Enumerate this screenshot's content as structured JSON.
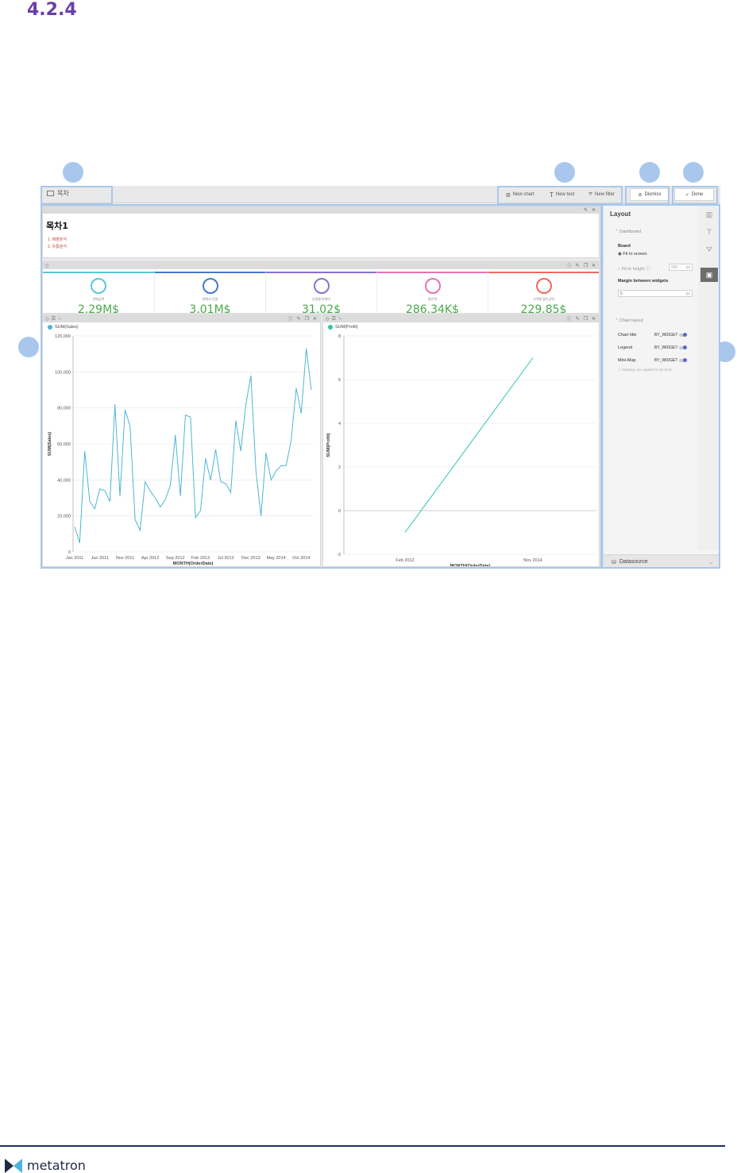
{
  "doc": {
    "section_number": "4.2.4",
    "brand": "metatron"
  },
  "toolbar": {
    "title": "목차",
    "new_chart": "New chart",
    "new_text": "New text",
    "new_filter": "New filter",
    "dismiss": "Dismiss",
    "done": "Done"
  },
  "text_widget": {
    "heading": "목차1",
    "links": [
      "1. 매출분석",
      "2. 유통분석"
    ]
  },
  "kpis": [
    {
      "label": "판매금액",
      "value": "2.29M$",
      "color": "#5bc4d9"
    },
    {
      "label": "판매자 인원",
      "value": "3.01M$",
      "color": "#4678c7"
    },
    {
      "label": "상품별 판매가",
      "value": "31.02$",
      "color": "#8a6fd0"
    },
    {
      "label": "할인액",
      "value": "286.34K$",
      "color": "#e870b4"
    },
    {
      "label": "고객별 할인금액",
      "value": "229.85$",
      "color": "#f06a5a"
    }
  ],
  "chart_data": [
    {
      "type": "line",
      "title": "",
      "legend": "SUM(Sales)",
      "xlabel": "MONTH(OrderDate)",
      "ylabel": "SUM(Sales)",
      "ylim": [
        0,
        120000
      ],
      "yticks": [
        "0",
        "20,000",
        "40,000",
        "60,000",
        "80,000",
        "100,000",
        "120,000"
      ],
      "xticks": [
        "Jan 2011",
        "Jun 2011",
        "Nov 2011",
        "Apr 2012",
        "Sep 2012",
        "Feb 2013",
        "Jul 2013",
        "Dec 2013",
        "May 2014",
        "Oct 2014"
      ],
      "color": "#4db6d6",
      "values": [
        14000,
        5000,
        56000,
        28000,
        24000,
        35000,
        34000,
        28000,
        82000,
        31000,
        79000,
        70000,
        18000,
        12000,
        39000,
        34000,
        30000,
        25000,
        29000,
        37000,
        65000,
        31000,
        76000,
        75000,
        19000,
        23000,
        52000,
        40000,
        57000,
        39000,
        38000,
        33000,
        73000,
        56000,
        82000,
        98000,
        45000,
        20000,
        55000,
        40000,
        45000,
        48000,
        48000,
        62000,
        91000,
        77000,
        113000,
        90000
      ]
    },
    {
      "type": "line",
      "title": "",
      "legend": "SUM(Profit)",
      "xlabel": "MONTH(OrderDate)",
      "ylabel": "SUM(Profit)",
      "ylim": [
        -2,
        8
      ],
      "yticks": [
        "-2",
        "0",
        "2",
        "4",
        "6",
        "8"
      ],
      "xticks": [
        "Feb 2012",
        "Nov 2014"
      ],
      "color": "#2dc6b0",
      "points": [
        {
          "x": "Feb 2012",
          "y": -1
        },
        {
          "x": "Nov 2014",
          "y": 7
        }
      ]
    }
  ],
  "panel": {
    "title": "Layout",
    "dashboard_section": "Dashboard",
    "board_label": "Board",
    "fit_to_screen": "Fit to screen",
    "fit_to_height": "Fit to height",
    "height_value": "900",
    "unit": "px",
    "margin_label": "Margin between widgets",
    "margin_value": "5",
    "chart_layout_section": "Chart layout",
    "settings": [
      {
        "label": "Chart title",
        "value": "BY_WIDGET"
      },
      {
        "label": "Legend",
        "value": "BY_WIDGET"
      },
      {
        "label": "Mini-Map",
        "value": "BY_WIDGET"
      }
    ],
    "note": "Settings are applied to all chart.",
    "datasource": "Datasource"
  }
}
